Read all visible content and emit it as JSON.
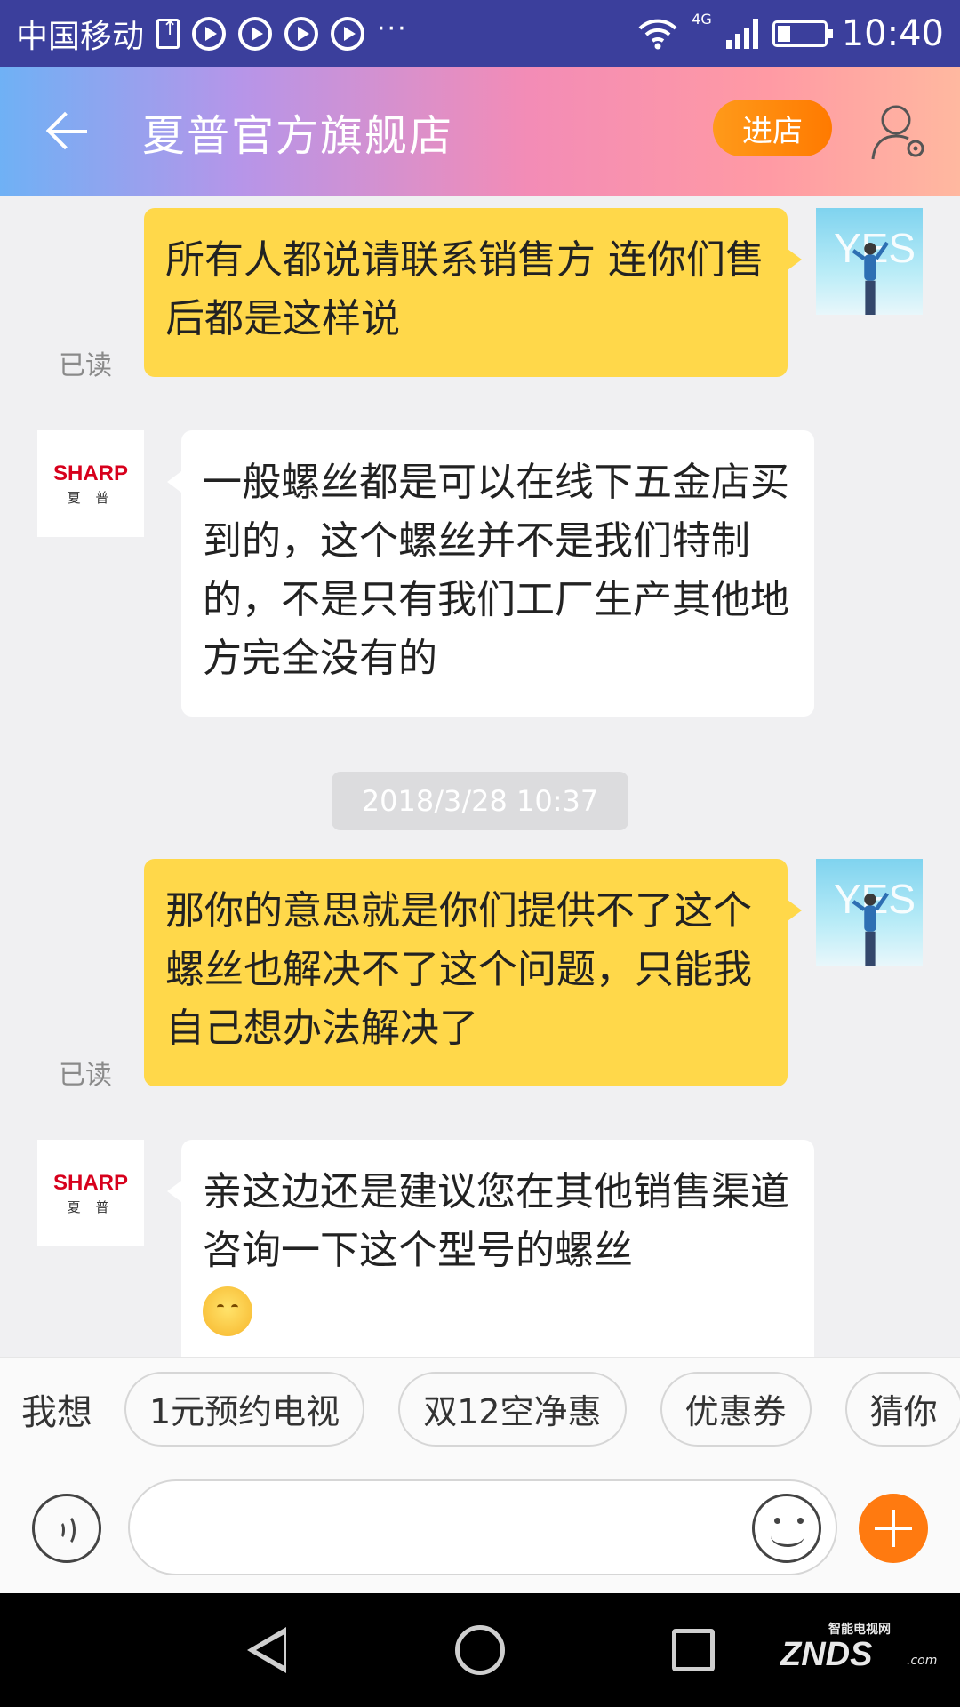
{
  "status_bar": {
    "carrier": "中国移动",
    "network": "4G",
    "time": "10:40",
    "dots": "···"
  },
  "header": {
    "title": "夏普官方旗舰店",
    "enter_label": "进店"
  },
  "messages": [
    {
      "sender": "me",
      "text": "所有人都说请联系销售方  连你们售后都是这样说",
      "read_label": "已读"
    },
    {
      "sender": "shop",
      "text": "一般螺丝都是可以在线下五金店买到的，这个螺丝并不是我们特制的，不是只有我们工厂生产其他地方完全没有的"
    },
    {
      "sender": "me",
      "text": "那你的意思就是你们提供不了这个螺丝也解决不了这个问题，只能我自己想办法解决了",
      "read_label": "已读"
    },
    {
      "sender": "shop",
      "text": "亲这边还是建议您在其他销售渠道咨询一下这个型号的螺丝"
    }
  ],
  "timestamp": "2018/3/28 10:37",
  "avatars": {
    "me_text": "YES",
    "shop_brand": "SHARP",
    "shop_brand_cn": "夏 普"
  },
  "suggestions": {
    "label": "我想",
    "chips": [
      "1元预约电视",
      "双12空净惠",
      "优惠券",
      "猜你"
    ]
  },
  "watermark": {
    "cn": "智能电视网",
    "en": "ZNDS",
    "suffix": ".com"
  },
  "colors": {
    "accent_orange": "#ff7a10",
    "my_bubble": "#ffd84a",
    "shop_red": "#d7001c"
  }
}
